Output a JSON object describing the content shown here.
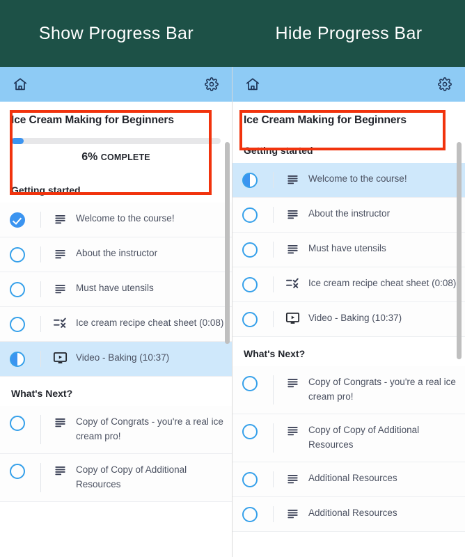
{
  "header": {
    "left_caption": "Show Progress Bar",
    "right_caption": "Hide Progress Bar",
    "background_color": "#1d5147",
    "text_color": "#ffffff"
  },
  "colors": {
    "app_bar": "#8ecbf5",
    "accent_blue": "#3b94f0",
    "circle_outline": "#35a0ea",
    "highlight_row": "#cfe8fb",
    "annotation_red": "#f1330d",
    "text_primary": "#22252c",
    "text_secondary": "#4b5161"
  },
  "app_bar": {
    "home_icon": "home-icon",
    "settings_icon": "gear-icon"
  },
  "left_panel": {
    "name": "show-progress-bar-panel",
    "course_title": "Ice Cream Making for Beginners",
    "progress_visible": true,
    "progress": {
      "percent": 6,
      "percent_label": "6%",
      "complete_label": "COMPLETE"
    },
    "sections": [
      {
        "heading": "Getting started",
        "items": [
          {
            "label": "Welcome to the course!",
            "status": "done",
            "type_icon": "article-icon",
            "highlight": false
          },
          {
            "label": "About the instructor",
            "status": "not-started",
            "type_icon": "article-icon",
            "highlight": false
          },
          {
            "label": "Must have utensils",
            "status": "not-started",
            "type_icon": "article-icon",
            "highlight": false
          },
          {
            "label": "Ice cream recipe cheat sheet (0:08)",
            "status": "not-started",
            "type_icon": "quiz-icon",
            "highlight": false
          },
          {
            "label": "Video - Baking (10:37)",
            "status": "in-progress",
            "type_icon": "video-icon",
            "highlight": true
          }
        ]
      },
      {
        "heading": "What's Next?",
        "items": [
          {
            "label": "Copy of Congrats - you're a real ice cream pro!",
            "status": "not-started",
            "type_icon": "article-icon",
            "highlight": false
          },
          {
            "label": "Copy of Copy of Additional Resources",
            "status": "not-started",
            "type_icon": "article-icon",
            "highlight": false
          }
        ]
      }
    ]
  },
  "right_panel": {
    "name": "hide-progress-bar-panel",
    "course_title": "Ice Cream Making for Beginners",
    "progress_visible": false,
    "sections": [
      {
        "heading": "Getting started",
        "items": [
          {
            "label": "Welcome to the course!",
            "status": "in-progress",
            "type_icon": "article-icon",
            "highlight": true
          },
          {
            "label": "About the instructor",
            "status": "not-started",
            "type_icon": "article-icon",
            "highlight": false
          },
          {
            "label": "Must have utensils",
            "status": "not-started",
            "type_icon": "article-icon",
            "highlight": false
          },
          {
            "label": "Ice cream recipe cheat sheet (0:08)",
            "status": "not-started",
            "type_icon": "quiz-icon",
            "highlight": false
          },
          {
            "label": "Video - Baking (10:37)",
            "status": "not-started",
            "type_icon": "video-icon",
            "highlight": false
          }
        ]
      },
      {
        "heading": "What's Next?",
        "items": [
          {
            "label": "Copy of Congrats - you're a real ice cream pro!",
            "status": "not-started",
            "type_icon": "article-icon",
            "highlight": false
          },
          {
            "label": "Copy of Copy of Additional Resources",
            "status": "not-started",
            "type_icon": "article-icon",
            "highlight": false
          },
          {
            "label": "Additional Resources",
            "status": "not-started",
            "type_icon": "article-icon",
            "highlight": false
          },
          {
            "label": "Additional Resources",
            "status": "not-started",
            "type_icon": "article-icon",
            "highlight": false
          }
        ]
      }
    ]
  }
}
